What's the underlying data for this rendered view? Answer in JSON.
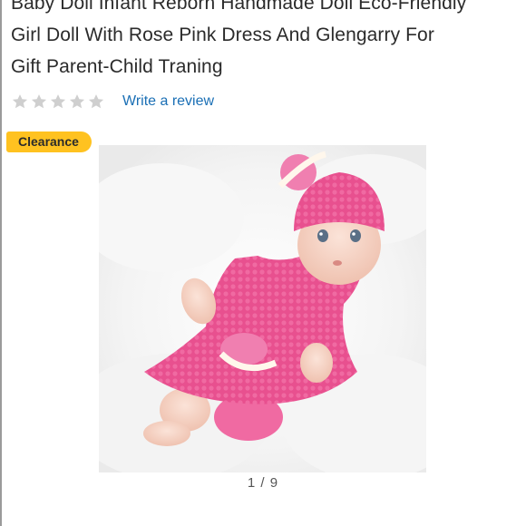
{
  "product": {
    "title_lines": [
      "Baby Doll Infant Reborn Handmade Doll Eco-Friendly",
      "Girl Doll With Rose Pink Dress And Glengarry For",
      "Gift Parent-Child Traning"
    ],
    "rating": {
      "stars_filled": 0,
      "stars_total": 5,
      "review_link": "Write a review"
    },
    "badge": "Clearance",
    "image": {
      "description_icon": "crochet-doll-photo",
      "pager": "1 / 9"
    }
  },
  "colors": {
    "badge_bg": "#ffc220",
    "link": "#1a6fb5",
    "star_empty": "#cfcfcf",
    "dress_pink": "#e8508f"
  }
}
